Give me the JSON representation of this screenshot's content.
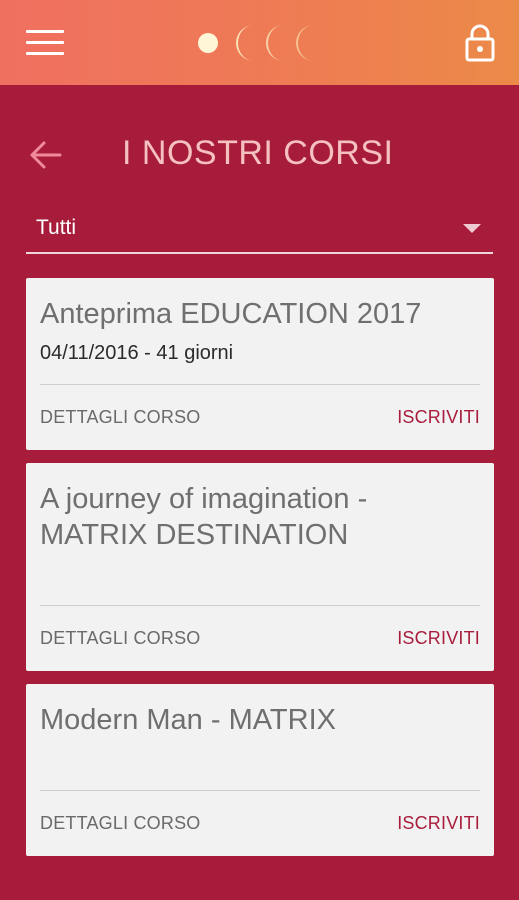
{
  "topbar": {
    "menu_icon": "hamburger-menu-icon",
    "logo_icon": "moon-phases-logo",
    "lock_icon": "lock-icon",
    "colors": {
      "gradient_start": "#f07060",
      "gradient_end": "#ec8a48"
    }
  },
  "header": {
    "back_icon": "arrow-left-icon",
    "title": "I NOSTRI CORSI"
  },
  "filter": {
    "selected": "Tutti"
  },
  "courses": [
    {
      "title": "Anteprima EDUCATION 2017",
      "date": "04/11/2016 - 41 giorni",
      "details_label": "DETTAGLI CORSO",
      "subscribe_label": "ISCRIVITI"
    },
    {
      "title": "A journey of imagination - MATRIX DESTINATION",
      "date": "",
      "details_label": "DETTAGLI CORSO",
      "subscribe_label": "ISCRIVITI"
    },
    {
      "title": "Modern Man - MATRIX",
      "date": "",
      "details_label": "DETTAGLI CORSO",
      "subscribe_label": "ISCRIVITI"
    }
  ],
  "colors": {
    "background": "#a61c3a",
    "card": "#f2f2f2",
    "accent": "#a81d3c"
  }
}
